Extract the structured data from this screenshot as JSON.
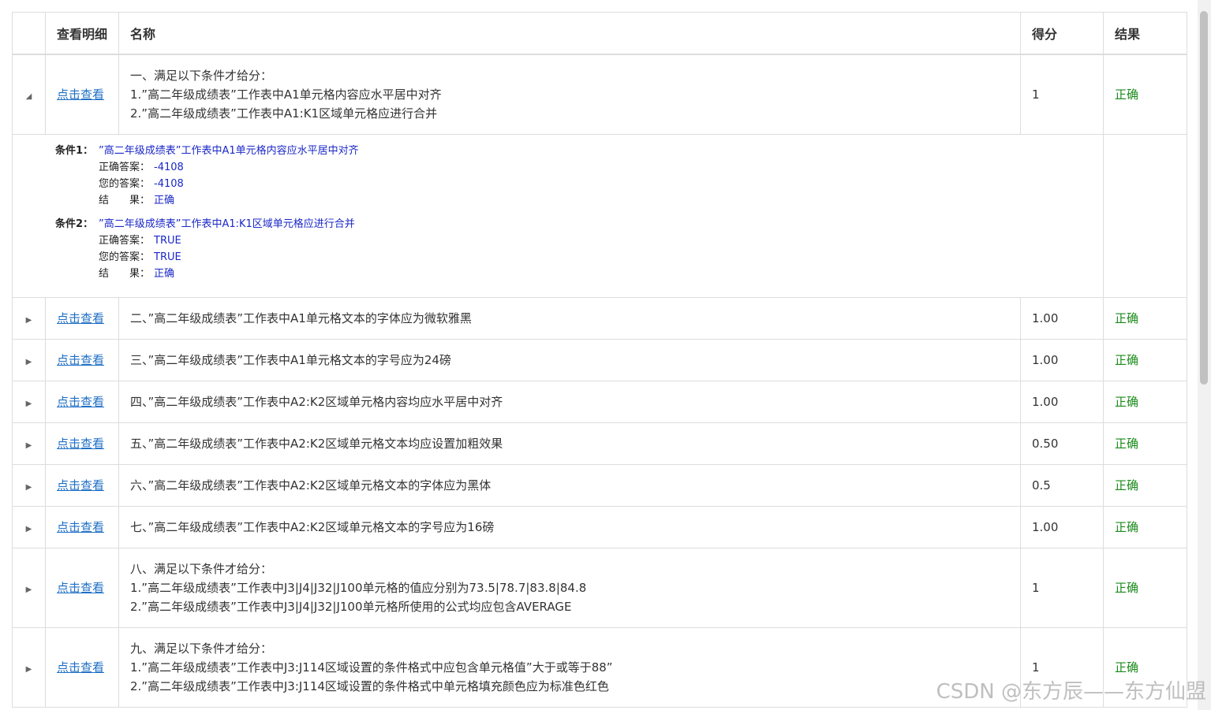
{
  "headers": {
    "expand": "",
    "detail": "查看明细",
    "name": "名称",
    "score": "得分",
    "result": "结果"
  },
  "view_link": "点击查看",
  "rows": [
    {
      "lines": [
        "一、满足以下条件才给分：",
        "1.”高二年级成绩表”工作表中A1单元格内容应水平居中对齐",
        "2.”高二年级成绩表”工作表中A1:K1区域单元格应进行合并"
      ],
      "score": "1",
      "result": "正确",
      "expanded": true
    },
    {
      "lines": [
        "二、”高二年级成绩表”工作表中A1单元格文本的字体应为微软雅黑"
      ],
      "score": "1.00",
      "result": "正确"
    },
    {
      "lines": [
        "三、”高二年级成绩表”工作表中A1单元格文本的字号应为24磅"
      ],
      "score": "1.00",
      "result": "正确"
    },
    {
      "lines": [
        "四、”高二年级成绩表”工作表中A2:K2区域单元格内容均应水平居中对齐"
      ],
      "score": "1.00",
      "result": "正确"
    },
    {
      "lines": [
        "五、”高二年级成绩表”工作表中A2:K2区域单元格文本均应设置加粗效果"
      ],
      "score": "0.50",
      "result": "正确"
    },
    {
      "lines": [
        "六、”高二年级成绩表”工作表中A2:K2区域单元格文本的字体应为黑体"
      ],
      "score": "0.5",
      "result": "正确"
    },
    {
      "lines": [
        "七、”高二年级成绩表”工作表中A2:K2区域单元格文本的字号应为16磅"
      ],
      "score": "1.00",
      "result": "正确"
    },
    {
      "lines": [
        "八、满足以下条件才给分：",
        "1.”高二年级成绩表”工作表中J3|J4|J32|J100单元格的值应分别为73.5|78.7|83.8|84.8",
        "2.”高二年级成绩表”工作表中J3|J4|J32|J100单元格所使用的公式均应包含AVERAGE"
      ],
      "score": "1",
      "result": "正确"
    },
    {
      "lines": [
        "九、满足以下条件才给分：",
        "1.”高二年级成绩表”工作表中J3:J114区域设置的条件格式中应包含单元格值”大于或等于88”",
        "2.”高二年级成绩表”工作表中J3:J114区域设置的条件格式中单元格填充颜色应为标准色红色"
      ],
      "score": "1",
      "result": "正确"
    }
  ],
  "detail": {
    "conditions": [
      {
        "label": "条件1：",
        "text": "”高二年级成绩表”工作表中A1单元格内容应水平居中对齐",
        "correct_key": "正确答案：",
        "correct": "-4108",
        "yours_key": "您的答案：",
        "yours": "-4108",
        "result_key": "结　　果：",
        "result": "正确"
      },
      {
        "label": "条件2：",
        "text": "”高二年级成绩表”工作表中A1:K1区域单元格应进行合并",
        "correct_key": "正确答案：",
        "correct": "TRUE",
        "yours_key": "您的答案：",
        "yours": "TRUE",
        "result_key": "结　　果：",
        "result": "正确"
      }
    ]
  },
  "watermark": "CSDN @东方辰——东方仙盟",
  "colors": {
    "link": "#1f6fc5",
    "result": "#1a8a1a",
    "detail_value": "#1a27c8",
    "border": "#dddddd"
  },
  "icons": {
    "expanded": "triangle-down-icon",
    "collapsed": "triangle-right-icon"
  }
}
